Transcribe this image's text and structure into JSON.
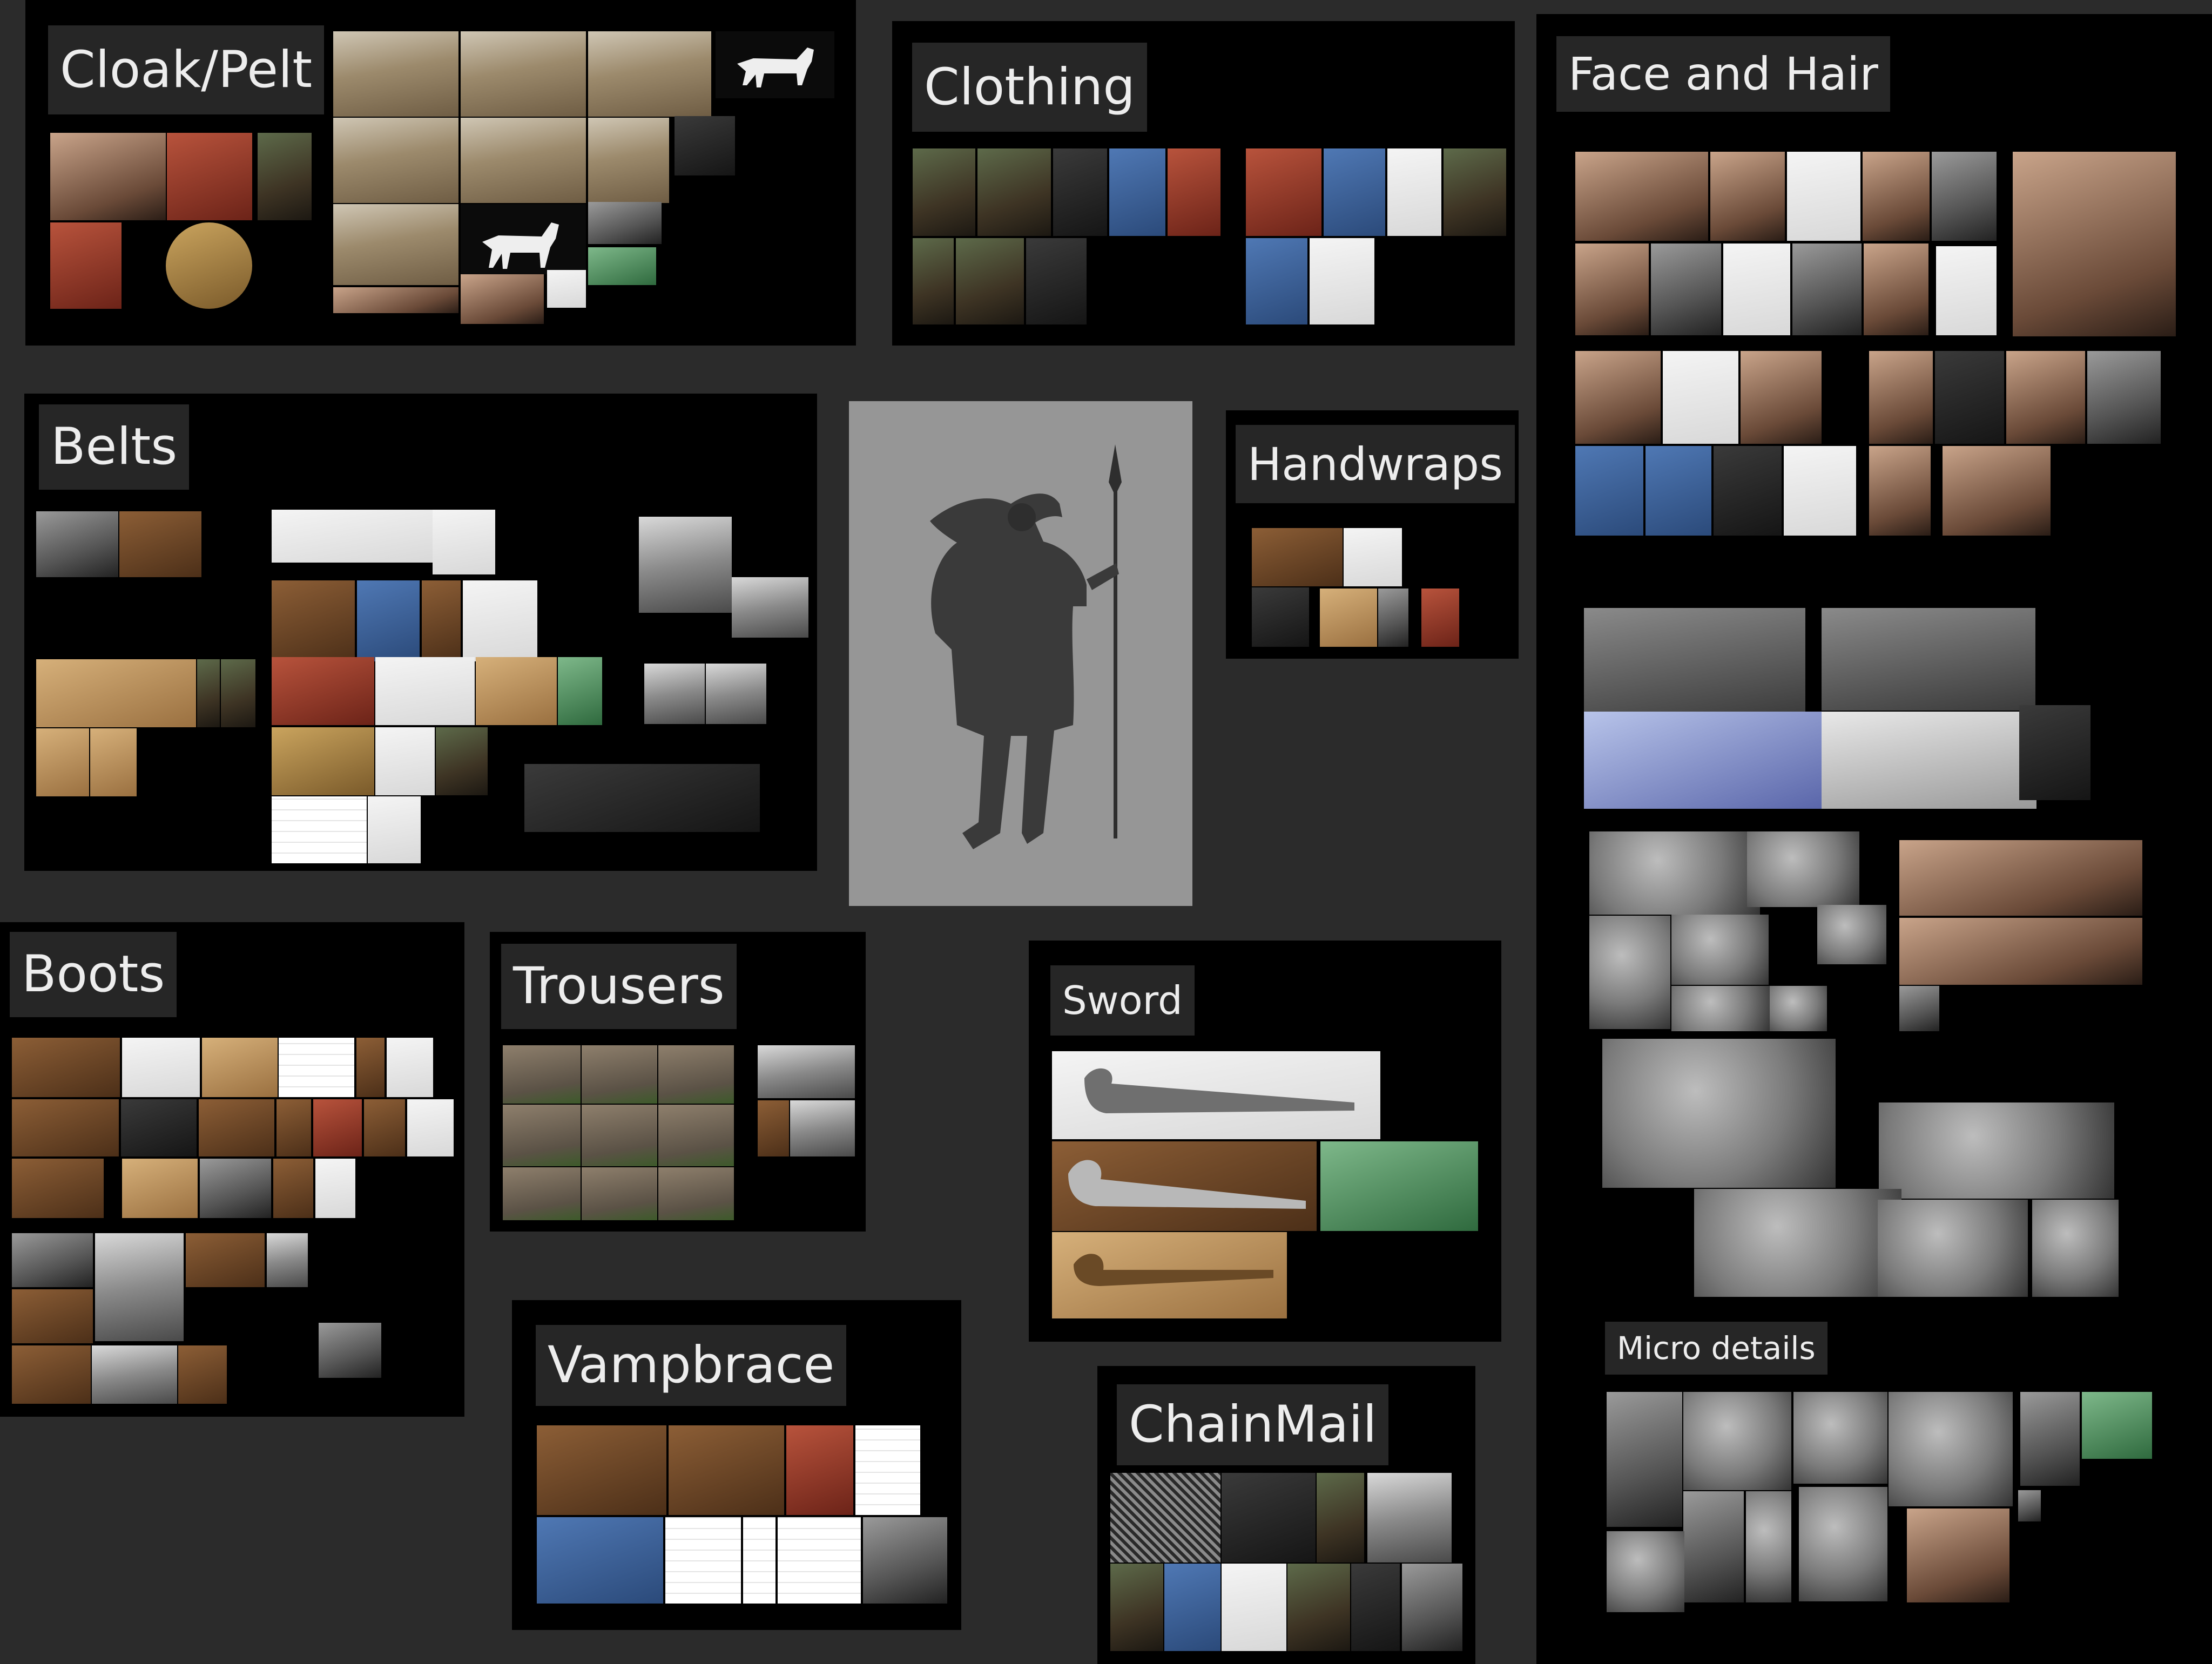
{
  "board": {
    "groups": {
      "cloak": {
        "title": "Cloak/Pelt"
      },
      "clothing": {
        "title": "Clothing"
      },
      "face_hair": {
        "title": "Face and Hair"
      },
      "belts": {
        "title": "Belts"
      },
      "handwraps": {
        "title": "Handwraps"
      },
      "boots": {
        "title": "Boots"
      },
      "trousers": {
        "title": "Trousers"
      },
      "sword": {
        "title": "Sword"
      },
      "vampbrace": {
        "title": "Vampbrace"
      },
      "chainmail": {
        "title": "ChainMail"
      },
      "micro": {
        "title": "Micro details"
      }
    }
  },
  "colors": {
    "canvas": "#2b2b2b",
    "group_panel": "#000000",
    "label_bg": "#262626",
    "label_text": "#ededed",
    "concept_bg": "#969696",
    "concept_figure": "#3a3a3a"
  }
}
